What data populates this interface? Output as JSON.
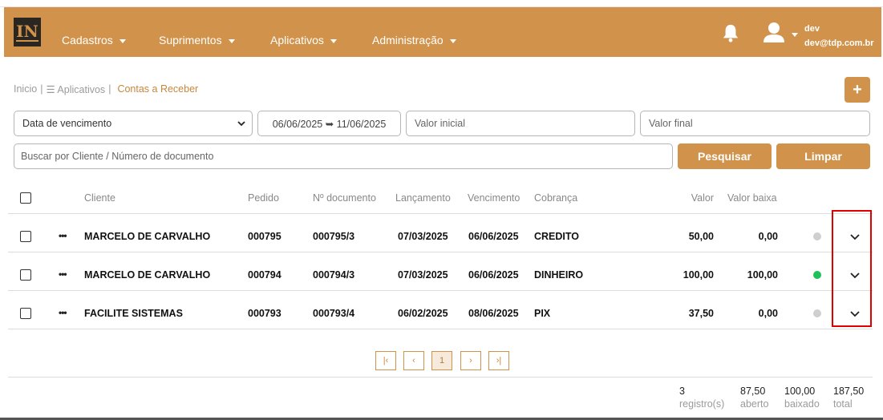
{
  "app": {
    "logo_text": "IN"
  },
  "nav": {
    "menus": [
      "Cadastros",
      "Suprimentos",
      "Aplicativos",
      "Administração"
    ],
    "user_name": "dev",
    "user_email": "dev@tdp.com.br"
  },
  "breadcrumb": {
    "home": "Inicio",
    "sep1": "|",
    "apps": "☰ Aplicativos",
    "sep2": "|",
    "current": "Contas a Receber"
  },
  "toolbar": {
    "add_label": "+"
  },
  "filters": {
    "date_type": "Data de vencimento",
    "date_range": "06/06/2025 ➥ 11/06/2025",
    "valor_inicial_placeholder": "Valor inicial",
    "valor_final_placeholder": "Valor final",
    "search_placeholder": "Buscar por Cliente / Número de documento",
    "search_button": "Pesquisar",
    "clear_button": "Limpar"
  },
  "table": {
    "headers": {
      "cliente": "Cliente",
      "pedido": "Pedido",
      "documento": "Nº documento",
      "lancamento": "Lançamento",
      "vencimento": "Vencimento",
      "cobranca": "Cobrança",
      "valor": "Valor",
      "valor_baixa": "Valor baixa"
    },
    "row_menu": "•••",
    "rows": [
      {
        "cliente": "MARCELO DE CARVALHO",
        "pedido": "000795",
        "documento": "000795/3",
        "lancamento": "07/03/2025",
        "vencimento": "06/06/2025",
        "cobranca": "CREDITO",
        "valor": "50,00",
        "valor_baixa": "0,00",
        "status_color": "#cfcfcf"
      },
      {
        "cliente": "MARCELO DE CARVALHO",
        "pedido": "000794",
        "documento": "000794/3",
        "lancamento": "07/03/2025",
        "vencimento": "06/06/2025",
        "cobranca": "DINHEIRO",
        "valor": "100,00",
        "valor_baixa": "100,00",
        "status_color": "#1fc15a"
      },
      {
        "cliente": "FACILITE SISTEMAS",
        "pedido": "000793",
        "documento": "000793/4",
        "lancamento": "06/02/2025",
        "vencimento": "08/06/2025",
        "cobranca": "PIX",
        "valor": "37,50",
        "valor_baixa": "0,00",
        "status_color": "#cfcfcf"
      }
    ]
  },
  "pagination": {
    "first": "|‹",
    "prev": "‹",
    "current": "1",
    "next": "›",
    "last": "›|"
  },
  "summary": {
    "count": "3",
    "count_label": "registro(s)",
    "aberto": "87,50",
    "aberto_label": "aberto",
    "baixado": "100,00",
    "baixado_label": "baixado",
    "total": "187,50",
    "total_label": "total"
  },
  "colors": {
    "brand": "#d1934b",
    "highlight": "#e00000"
  }
}
